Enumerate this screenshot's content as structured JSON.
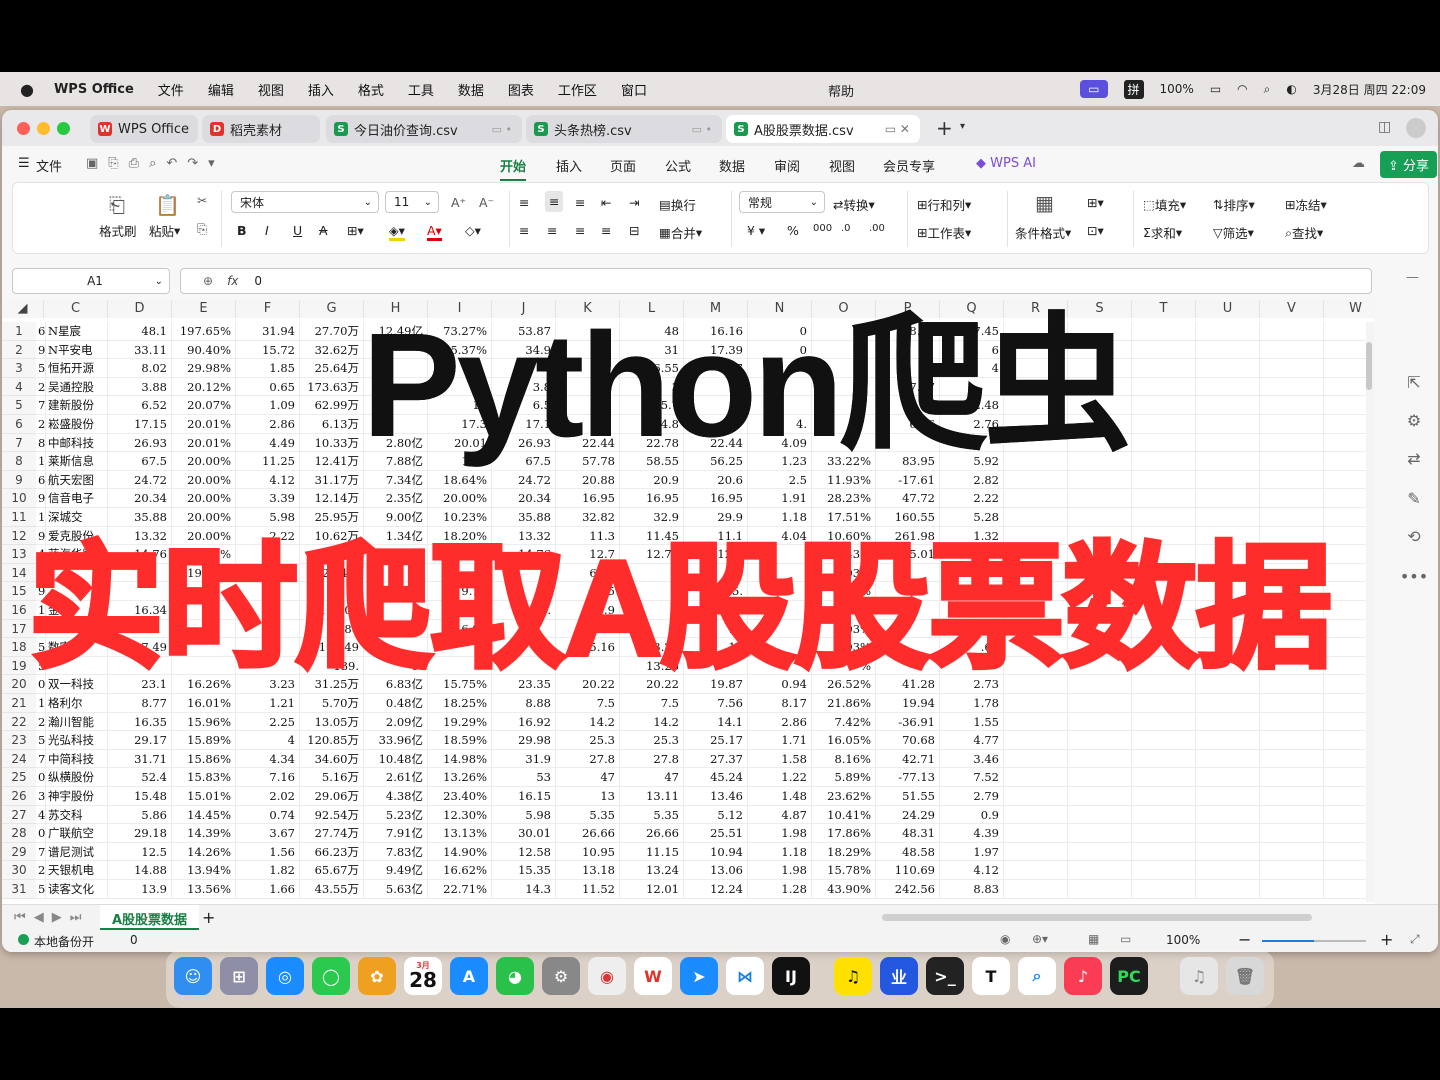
{
  "menubar": {
    "apple": "",
    "app": "WPS Office",
    "items": [
      "文件",
      "编辑",
      "视图",
      "插入",
      "格式",
      "工具",
      "数据",
      "图表",
      "工作区",
      "窗口"
    ],
    "help": "帮助",
    "ime": "拼",
    "battery": "100%",
    "datetime": "3月28日 周四  22:09"
  },
  "tabs": [
    {
      "label": "WPS Office",
      "icon": "wps-logo",
      "color": "#e0332b"
    },
    {
      "label": "稻壳素材",
      "icon": "docer-logo",
      "color": "#e0332b"
    },
    {
      "label": "今日油价查询.csv",
      "icon": "S",
      "color": "#1a9a4f"
    },
    {
      "label": "头条热榜.csv",
      "icon": "S",
      "color": "#1a9a4f"
    },
    {
      "label": "A股股票数据.csv",
      "icon": "S",
      "color": "#1a9a4f"
    }
  ],
  "menu2": {
    "file": "文件",
    "tabs": [
      "开始",
      "插入",
      "页面",
      "公式",
      "数据",
      "审阅",
      "视图",
      "会员专享"
    ],
    "ai": "WPS AI",
    "share": "分享"
  },
  "ribbon": {
    "format_painter": "格式刷",
    "paste": "粘贴",
    "font": "宋体",
    "size": "11",
    "wrap": "换行",
    "merge": "合并",
    "numfmt": "常规",
    "convert": "转换",
    "rowcol": "行和列",
    "sheet": "工作表",
    "condfmt": "条件格式",
    "fill": "填充",
    "sort": "排序",
    "freeze": "冻结",
    "sum": "求和",
    "filter": "筛选",
    "find": "查找"
  },
  "formula": {
    "cellref": "A1",
    "fx": "fx",
    "value": "0"
  },
  "columns": [
    "C",
    "D",
    "E",
    "F",
    "G",
    "H",
    "I",
    "J",
    "K",
    "L",
    "M",
    "N",
    "O",
    "P",
    "Q",
    "R",
    "S",
    "T",
    "U",
    "V",
    "W"
  ],
  "rows": [
    [
      "1",
      "6",
      "N星宸",
      "48.1",
      "197.65%",
      "31.94",
      "27.70万",
      "12.49亿",
      "73.27%",
      "53.87",
      "",
      "48",
      "16.16",
      "0",
      "",
      "98.93",
      "7.45"
    ],
    [
      "2",
      "9",
      "N平安电",
      "33.11",
      "90.40%",
      "15.72",
      "32.62万",
      "",
      "35.37%",
      "34.9",
      "",
      "31",
      "17.39",
      "0",
      "",
      "",
      "6"
    ],
    [
      "3",
      "5",
      "恒拓开源",
      "8.02",
      "29.98%",
      "1.85",
      "25.64万",
      "",
      "",
      "",
      "",
      "6.55",
      "6.17",
      "",
      "",
      "",
      "4"
    ],
    [
      "4",
      "2",
      "吴通控股",
      "3.88",
      "20.12%",
      "0.65",
      "173.63万",
      "",
      "",
      "3.8",
      "",
      "3",
      "",
      "",
      "",
      "7.37",
      ""
    ],
    [
      "5",
      "7",
      "建新股份",
      "6.52",
      "20.07%",
      "1.09",
      "62.99万",
      "",
      "14",
      "6.5",
      "",
      "5.7",
      "",
      "",
      "",
      "",
      "2.48"
    ],
    [
      "6",
      "2",
      "崧盛股份",
      "17.15",
      "20.01%",
      "2.86",
      "6.13万",
      "",
      "17.3",
      "17.1",
      "",
      "14.8",
      "",
      "4.",
      "",
      "6.16",
      "2.76"
    ],
    [
      "7",
      "8",
      "中邮科技",
      "26.93",
      "20.01%",
      "4.49",
      "10.33万",
      "2.80亿",
      "20.01",
      "26.93",
      "22.44",
      "22.78",
      "22.44",
      "4.09",
      "",
      "",
      ""
    ],
    [
      "8",
      "1",
      "莱斯信息",
      "67.5",
      "20.00%",
      "11.25",
      "12.41万",
      "7.88亿",
      "17.2",
      "67.5",
      "57.78",
      "58.55",
      "56.25",
      "1.23",
      "33.22%",
      "83.95",
      "5.92"
    ],
    [
      "9",
      "6",
      "航天宏图",
      "24.72",
      "20.00%",
      "4.12",
      "31.17万",
      "7.34亿",
      "18.64%",
      "24.72",
      "20.88",
      "20.9",
      "20.6",
      "2.5",
      "11.93%",
      "-17.61",
      "2.82"
    ],
    [
      "10",
      "9",
      "信音电子",
      "20.34",
      "20.00%",
      "3.39",
      "12.14万",
      "2.35亿",
      "20.00%",
      "20.34",
      "16.95",
      "16.95",
      "16.95",
      "1.91",
      "28.23%",
      "47.72",
      "2.22"
    ],
    [
      "11",
      "1",
      "深城交",
      "35.88",
      "20.00%",
      "5.98",
      "25.95万",
      "9.00亿",
      "10.23%",
      "35.88",
      "32.82",
      "32.9",
      "29.9",
      "1.18",
      "17.51%",
      "160.55",
      "5.28"
    ],
    [
      "12",
      "9",
      "爱克股份",
      "13.32",
      "20.00%",
      "2.22",
      "10.62万",
      "1.34亿",
      "18.20%",
      "13.32",
      "11.3",
      "11.45",
      "11.1",
      "4.04",
      "10.60%",
      "261.98",
      "1.32"
    ],
    [
      "13",
      "4",
      "蓝海华腾",
      "14.76",
      "20.00%",
      "",
      "38.50万",
      "5.33亿",
      "16.75%",
      "14.76",
      "12.7",
      "12.75",
      "12.3",
      "",
      "23.43%",
      "105.01",
      "4.76"
    ],
    [
      "14",
      "5",
      "",
      "",
      "19.00%",
      "",
      "2.14万",
      "",
      "",
      "",
      "6.25",
      "",
      "33.",
      "",
      "8.03%",
      "",
      "4.77"
    ],
    [
      "15",
      "9",
      "",
      "",
      "",
      "",
      "",
      "",
      "9.14",
      "",
      "5.75",
      "",
      "15.",
      "",
      "%",
      "",
      ""
    ],
    [
      "16",
      "1",
      "金",
      "16.34",
      "",
      "",
      "103.08",
      "",
      "7.91",
      "6.",
      "13.9",
      "",
      "13.",
      "",
      "8.14%",
      "",
      "1"
    ],
    [
      "17",
      "9",
      "",
      "",
      "",
      "",
      "37.86",
      "",
      "6.97",
      "",
      "12.4",
      "",
      "13",
      "",
      "3.03%",
      "",
      "7"
    ],
    [
      "18",
      "5",
      "数字",
      "17.49",
      "",
      "",
      "102.49",
      "",
      "",
      "",
      "15.16",
      "13.21",
      "14",
      "",
      "9.93%",
      "",
      ".64"
    ],
    [
      "19",
      "5",
      "",
      "",
      "",
      "",
      "139.",
      "9.",
      "",
      "",
      "",
      "13.26",
      "",
      "",
      "%",
      "",
      ""
    ],
    [
      "20",
      "0",
      "双一科技",
      "23.1",
      "16.26%",
      "3.23",
      "31.25万",
      "6.83亿",
      "15.75%",
      "23.35",
      "20.22",
      "20.22",
      "19.87",
      "0.94",
      "26.52%",
      "41.28",
      "2.73"
    ],
    [
      "21",
      "1",
      "格利尔",
      "8.77",
      "16.01%",
      "1.21",
      "5.70万",
      "0.48亿",
      "18.25%",
      "8.88",
      "7.5",
      "7.5",
      "7.56",
      "8.17",
      "21.86%",
      "19.94",
      "1.78"
    ],
    [
      "22",
      "2",
      "瀚川智能",
      "16.35",
      "15.96%",
      "2.25",
      "13.05万",
      "2.09亿",
      "19.29%",
      "16.92",
      "14.2",
      "14.2",
      "14.1",
      "2.86",
      "7.42%",
      "-36.91",
      "1.55"
    ],
    [
      "23",
      "5",
      "光弘科技",
      "29.17",
      "15.89%",
      "4",
      "120.85万",
      "33.96亿",
      "18.59%",
      "29.98",
      "25.3",
      "25.3",
      "25.17",
      "1.71",
      "16.05%",
      "70.68",
      "4.77"
    ],
    [
      "24",
      "7",
      "中简科技",
      "31.71",
      "15.86%",
      "4.34",
      "34.60万",
      "10.48亿",
      "14.98%",
      "31.9",
      "27.8",
      "27.8",
      "27.37",
      "1.58",
      "8.16%",
      "42.71",
      "3.46"
    ],
    [
      "25",
      "0",
      "纵横股份",
      "52.4",
      "15.83%",
      "7.16",
      "5.16万",
      "2.61亿",
      "13.26%",
      "53",
      "47",
      "47",
      "45.24",
      "1.22",
      "5.89%",
      "-77.13",
      "7.52"
    ],
    [
      "26",
      "3",
      "神宇股份",
      "15.48",
      "15.01%",
      "2.02",
      "29.06万",
      "4.38亿",
      "23.40%",
      "16.15",
      "13",
      "13.11",
      "13.46",
      "1.48",
      "23.62%",
      "51.55",
      "2.79"
    ],
    [
      "27",
      "4",
      "苏交科",
      "5.86",
      "14.45%",
      "0.74",
      "92.54万",
      "5.23亿",
      "12.30%",
      "5.98",
      "5.35",
      "5.35",
      "5.12",
      "4.87",
      "10.41%",
      "24.29",
      "0.9"
    ],
    [
      "28",
      "0",
      "广联航空",
      "29.18",
      "14.39%",
      "3.67",
      "27.74万",
      "7.91亿",
      "13.13%",
      "30.01",
      "26.66",
      "26.66",
      "25.51",
      "1.98",
      "17.86%",
      "48.31",
      "4.39"
    ],
    [
      "29",
      "7",
      "谱尼测试",
      "12.5",
      "14.26%",
      "1.56",
      "66.23万",
      "7.83亿",
      "14.90%",
      "12.58",
      "10.95",
      "11.15",
      "10.94",
      "1.18",
      "18.29%",
      "48.58",
      "1.97"
    ],
    [
      "30",
      "2",
      "天银机电",
      "14.88",
      "13.94%",
      "1.82",
      "65.67万",
      "9.49亿",
      "16.62%",
      "15.35",
      "13.18",
      "13.24",
      "13.06",
      "1.98",
      "15.78%",
      "110.69",
      "4.12"
    ],
    [
      "31",
      "5",
      "读客文化",
      "13.9",
      "13.56%",
      "1.66",
      "43.55万",
      "5.63亿",
      "22.71%",
      "14.3",
      "11.52",
      "12.01",
      "12.24",
      "1.28",
      "43.90%",
      "242.56",
      "8.83"
    ]
  ],
  "sheet": {
    "tab": "A股股票数据",
    "add": "+"
  },
  "status": {
    "backup": "本地备份开",
    "count": "0",
    "zoom": "100%"
  },
  "overlay": {
    "title": "Python爬虫",
    "subtitle": "实时爬取A股股票数据"
  },
  "dock": {
    "calendar_month": "3月",
    "calendar_day": "28"
  }
}
